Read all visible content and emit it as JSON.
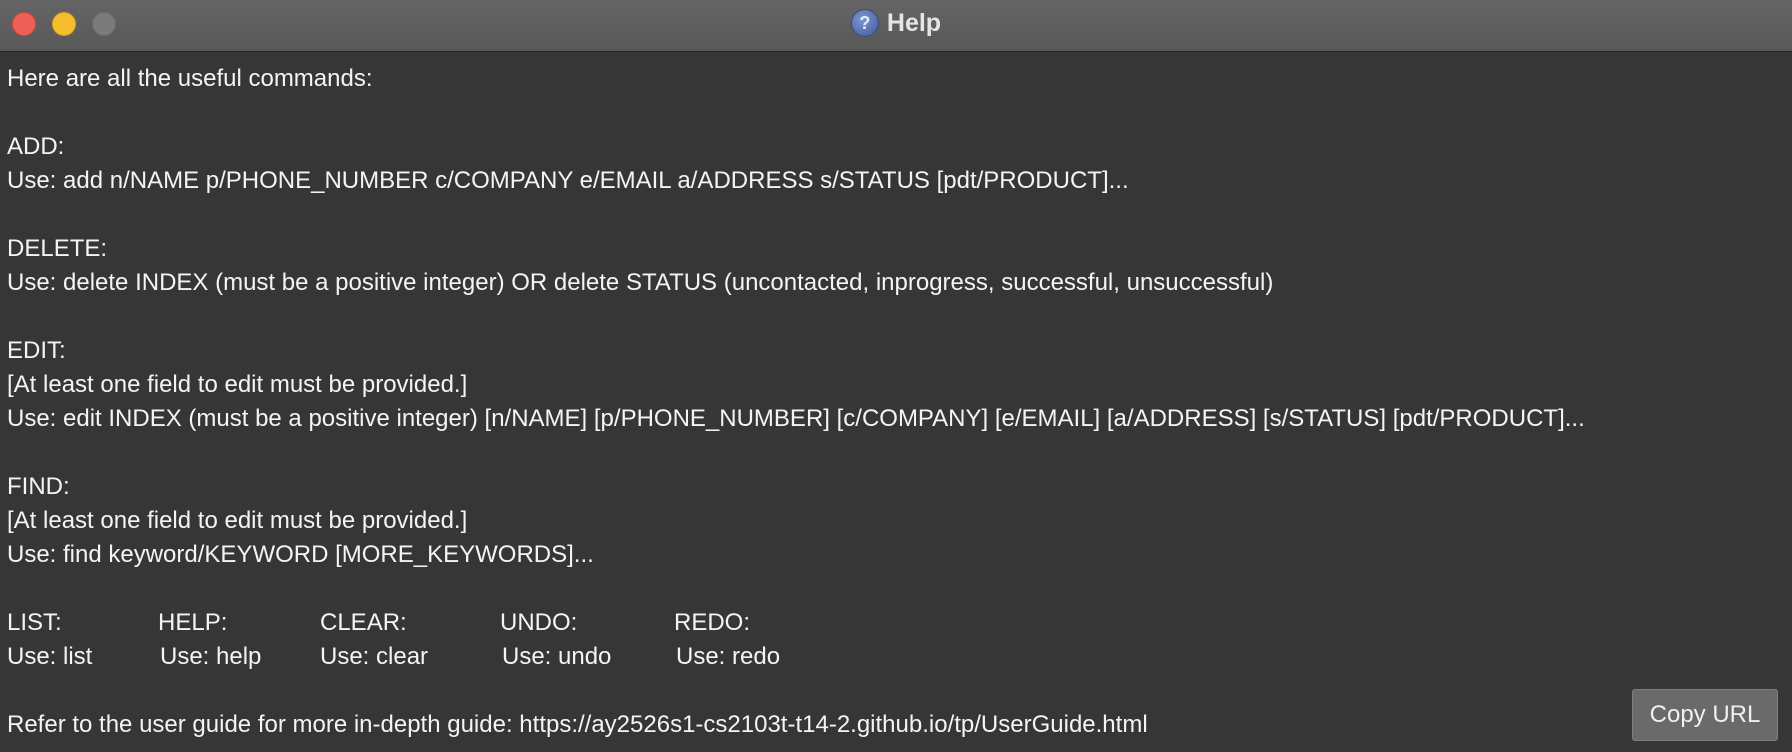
{
  "window": {
    "title": "Help",
    "title_icon": "help-question-icon"
  },
  "help": {
    "intro": "Here are all the useful commands:",
    "add_header": "ADD:",
    "add_usage": "Use: add n/NAME p/PHONE_NUMBER c/COMPANY e/EMAIL a/ADDRESS s/STATUS [pdt/PRODUCT]...",
    "delete_header": "DELETE:",
    "delete_usage": "Use: delete INDEX (must be a positive integer) OR delete STATUS (uncontacted, inprogress, successful, unsuccessful)",
    "edit_header": "EDIT:",
    "edit_note": "[At least one field to edit must be provided.]",
    "edit_usage": "Use: edit INDEX (must be a positive integer) [n/NAME] [p/PHONE_NUMBER] [c/COMPANY] [e/EMAIL] [a/ADDRESS] [s/STATUS] [pdt/PRODUCT]...",
    "find_header": "FIND:",
    "find_note": "[At least one field to edit must be provided.]",
    "find_usage": "Use: find keyword/KEYWORD [MORE_KEYWORDS]...",
    "simple_commands": [
      {
        "header": "LIST:",
        "usage": "Use: list"
      },
      {
        "header": "HELP:",
        "usage": "Use: help"
      },
      {
        "header": "CLEAR:",
        "usage": "Use: clear"
      },
      {
        "header": "UNDO:",
        "usage": "Use: undo"
      },
      {
        "header": "REDO:",
        "usage": "Use: redo"
      }
    ],
    "guide_text": "Refer to the user guide for more in-depth guide: https://ay2526s1-cs2103t-t14-2.github.io/tp/UserGuide.html"
  },
  "buttons": {
    "copy_url": "Copy URL"
  },
  "colors": {
    "background": "#363636",
    "titlebar": "#5e5e5e",
    "text": "#f4f4f4",
    "button": "#6a6a6a",
    "close": "#ee5f57",
    "minimize": "#f5bd2e",
    "zoom": "#7b7b7b"
  }
}
